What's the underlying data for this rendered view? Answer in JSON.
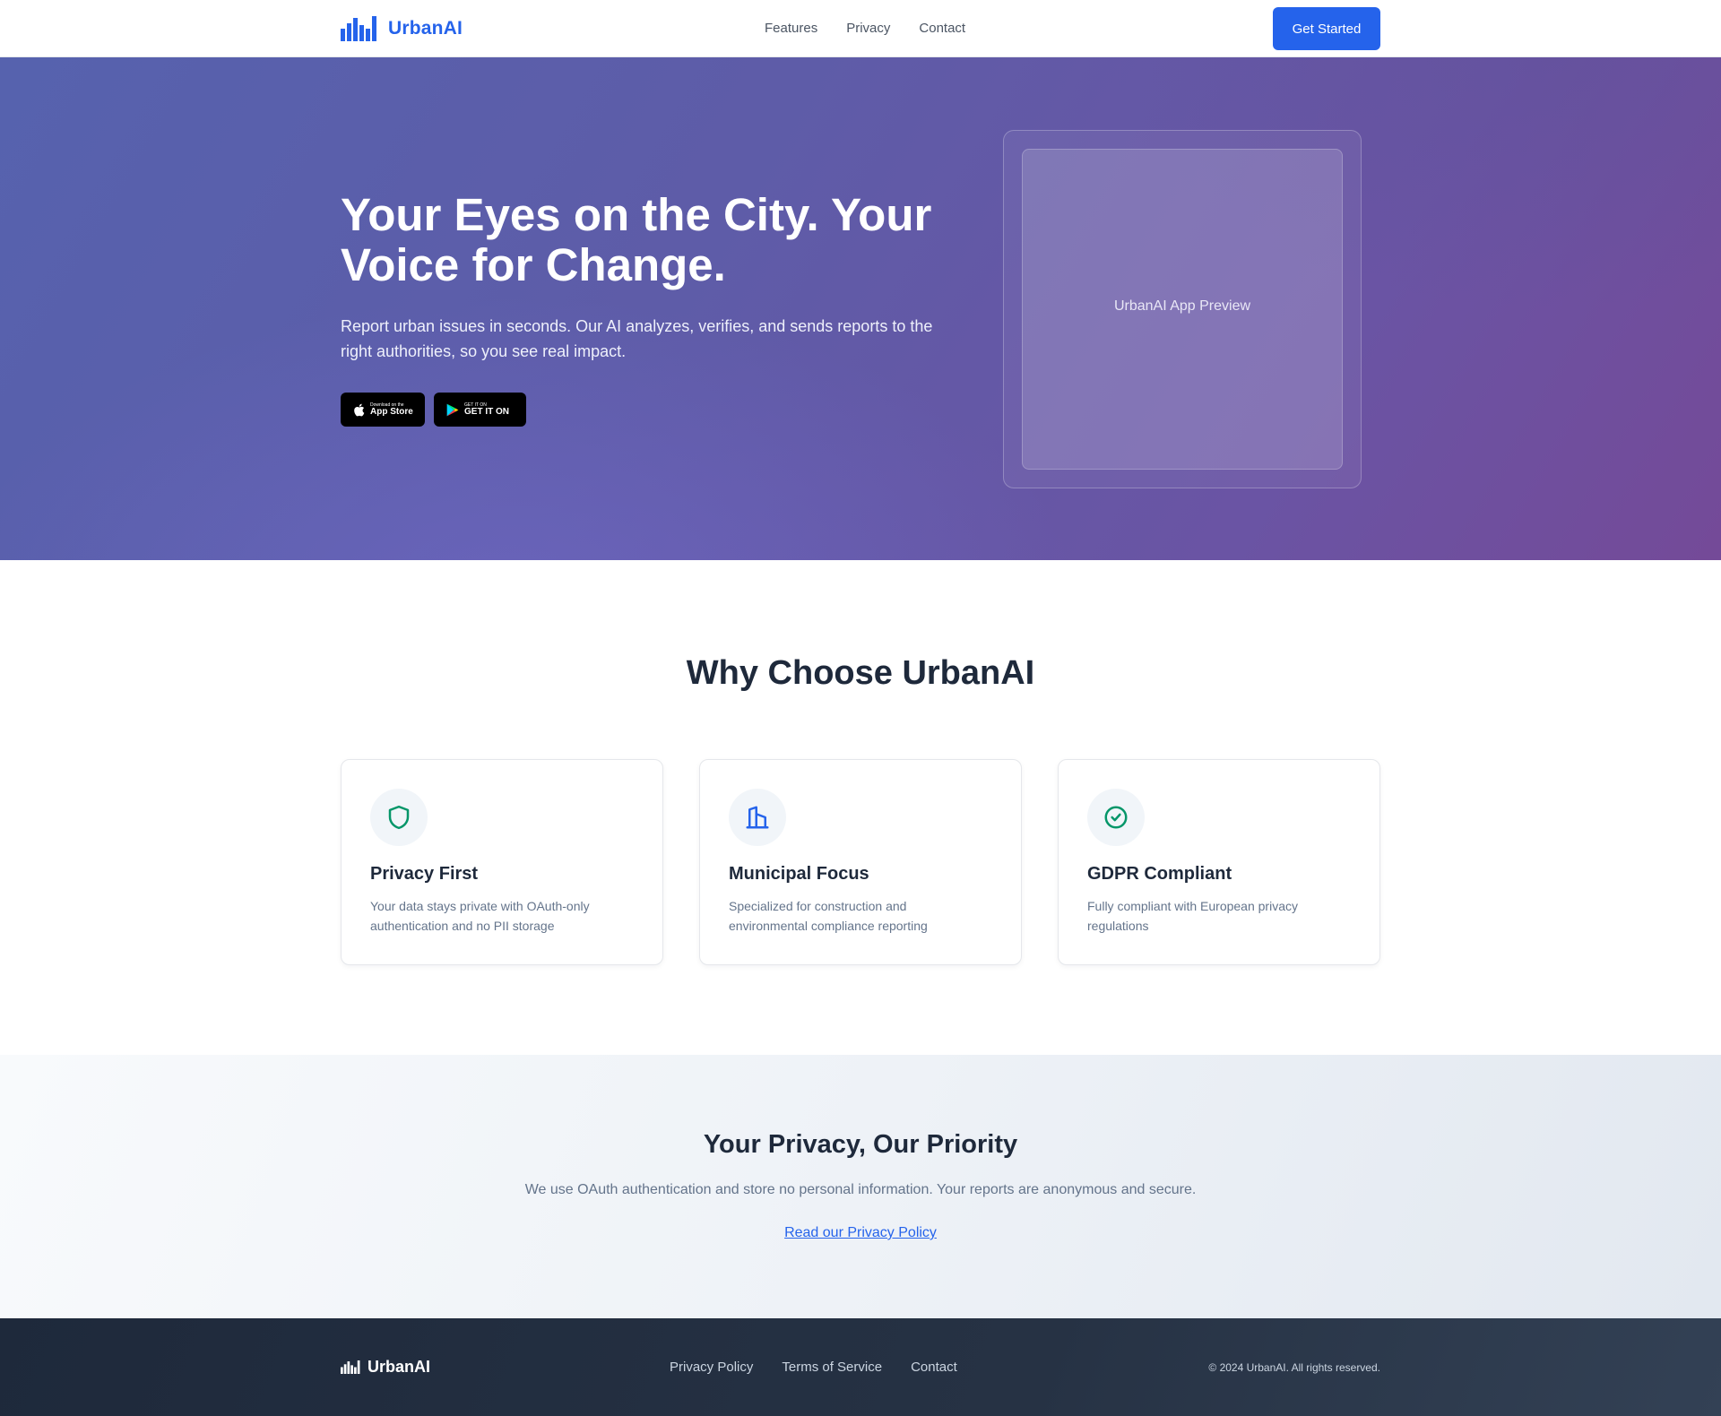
{
  "header": {
    "brand": "UrbanAI",
    "nav": [
      "Features",
      "Privacy",
      "Contact"
    ],
    "cta": "Get Started"
  },
  "hero": {
    "title": "Your Eyes on the City. Your Voice for Change.",
    "subtitle": "Report urban issues in seconds. Our AI analyzes, verifies, and sends reports to the right authorities, so you see real impact.",
    "app_store": {
      "small": "Download on the",
      "big": "App Store"
    },
    "google_play": {
      "small": "GET IT ON",
      "big": "GET IT ON"
    },
    "preview_label": "UrbanAI App Preview"
  },
  "features": {
    "title": "Why Choose UrbanAI",
    "cards": [
      {
        "title": "Privacy First",
        "description": "Your data stays private with OAuth-only authentication and no PII storage",
        "icon": "shield-icon"
      },
      {
        "title": "Municipal Focus",
        "description": "Specialized for construction and environmental compliance reporting",
        "icon": "building-icon"
      },
      {
        "title": "GDPR Compliant",
        "description": "Fully compliant with European privacy regulations",
        "icon": "check-circle-icon"
      }
    ]
  },
  "privacy": {
    "title": "Your Privacy, Our Priority",
    "text": "We use OAuth authentication and store no personal information. Your reports are anonymous and secure.",
    "link": "Read our Privacy Policy"
  },
  "footer": {
    "brand": "UrbanAI",
    "links": [
      "Privacy Policy",
      "Terms of Service",
      "Contact"
    ],
    "copyright": "© 2024 UrbanAI. All rights reserved."
  },
  "colors": {
    "primary": "#2563eb",
    "hero_start": "#5662ae",
    "hero_end": "#744a98",
    "footer": "#1e293b",
    "green_icon": "#059669"
  }
}
